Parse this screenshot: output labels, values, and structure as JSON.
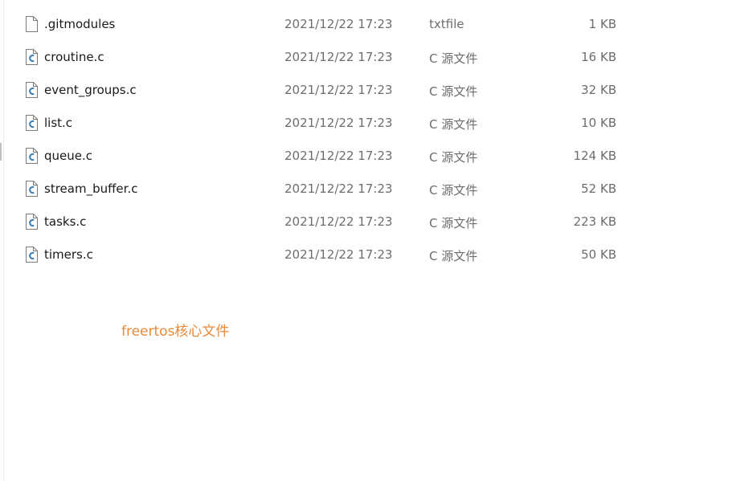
{
  "files": [
    {
      "name": ".gitmodules",
      "date": "2021/12/22 17:23",
      "type": "txtfile",
      "size": "1 KB",
      "icon": "text-file-icon"
    },
    {
      "name": "croutine.c",
      "date": "2021/12/22 17:23",
      "type": "C 源文件",
      "size": "16 KB",
      "icon": "c-source-file-icon"
    },
    {
      "name": "event_groups.c",
      "date": "2021/12/22 17:23",
      "type": "C 源文件",
      "size": "32 KB",
      "icon": "c-source-file-icon"
    },
    {
      "name": "list.c",
      "date": "2021/12/22 17:23",
      "type": "C 源文件",
      "size": "10 KB",
      "icon": "c-source-file-icon"
    },
    {
      "name": "queue.c",
      "date": "2021/12/22 17:23",
      "type": "C 源文件",
      "size": "124 KB",
      "icon": "c-source-file-icon"
    },
    {
      "name": "stream_buffer.c",
      "date": "2021/12/22 17:23",
      "type": "C 源文件",
      "size": "52 KB",
      "icon": "c-source-file-icon"
    },
    {
      "name": "tasks.c",
      "date": "2021/12/22 17:23",
      "type": "C 源文件",
      "size": "223 KB",
      "icon": "c-source-file-icon"
    },
    {
      "name": "timers.c",
      "date": "2021/12/22 17:23",
      "type": "C 源文件",
      "size": "50 KB",
      "icon": "c-source-file-icon"
    }
  ],
  "caption": "freertos核心文件",
  "colors": {
    "caption": "#e8893a",
    "name_text": "#1a1a1a",
    "meta_text": "#6d6d6d",
    "c_icon_accent": "#3d7fb8"
  }
}
